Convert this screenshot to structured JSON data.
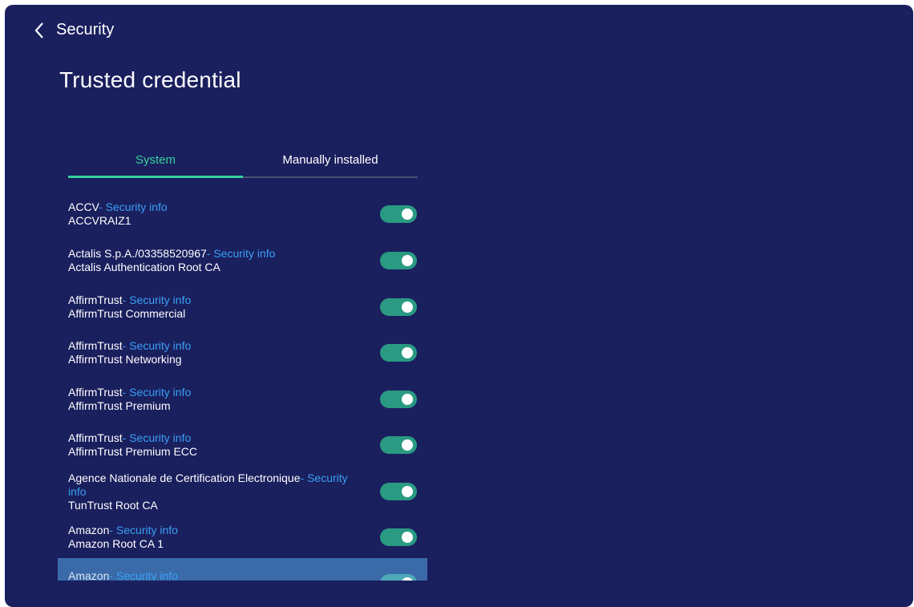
{
  "header": {
    "back_label": "Security",
    "title": "Trusted credential"
  },
  "tabs": [
    {
      "label": "System",
      "active": true
    },
    {
      "label": "Manually installed",
      "active": false
    }
  ],
  "security_info_label": "- Security info",
  "colors": {
    "background": "#1a1f5e",
    "accent_green": "#34d399",
    "link_blue": "#3aa0f5",
    "toggle_on": "#2a9a82",
    "highlight_row": "#3a6aa8"
  },
  "certificates": [
    {
      "issuer": "ACCV",
      "info": "- Security info",
      "name": "ACCVRAIZ1",
      "enabled": true
    },
    {
      "issuer": "Actalis S.p.A./03358520967",
      "info": "- Security info",
      "name": "Actalis Authentication Root CA",
      "enabled": true
    },
    {
      "issuer": "AffirmTrust",
      "info": "- Security info",
      "name": "AffirmTrust Commercial",
      "enabled": true
    },
    {
      "issuer": "AffirmTrust",
      "info": "- Security info",
      "name": "AffirmTrust Networking",
      "enabled": true
    },
    {
      "issuer": "AffirmTrust",
      "info": "- Security info",
      "name": "AffirmTrust Premium",
      "enabled": true
    },
    {
      "issuer": "AffirmTrust",
      "info": "- Security info",
      "name": "AffirmTrust Premium ECC",
      "enabled": true
    },
    {
      "issuer": "Agence Nationale de Certification Electronique",
      "info": "- Security info",
      "name": "TunTrust Root CA",
      "enabled": true
    },
    {
      "issuer": "Amazon",
      "info": "- Security info",
      "name": "Amazon Root CA 1",
      "enabled": true
    },
    {
      "issuer": "Amazon",
      "info": "- Security info",
      "name": "",
      "enabled": true,
      "highlighted": true
    }
  ]
}
